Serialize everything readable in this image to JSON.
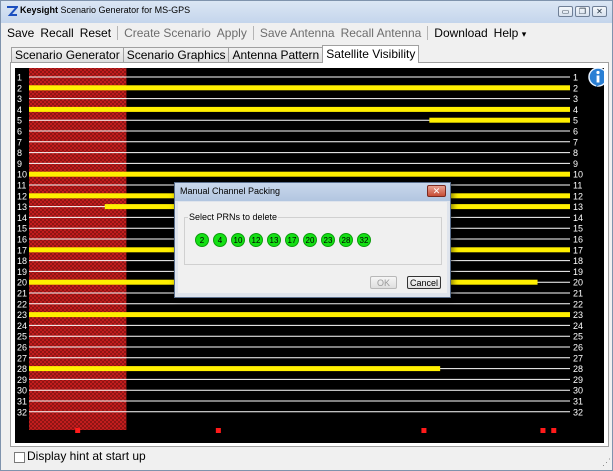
{
  "window": {
    "brand": "Keysight",
    "title": "Scenario Generator for MS-GPS",
    "controls": [
      "minimize-icon",
      "restore-icon",
      "close-icon"
    ]
  },
  "menu": {
    "save": "Save",
    "recall": "Recall",
    "reset": "Reset",
    "create_scenario": "Create Scenario",
    "apply": "Apply",
    "save_antenna": "Save Antenna",
    "recall_antenna": "Recall Antenna",
    "download": "Download",
    "help": "Help",
    "help_arrow": "▾"
  },
  "tabs": [
    "Scenario Generator",
    "Scenario Graphics",
    "Antenna Pattern",
    "Satellite Visibility"
  ],
  "active_tab": 3,
  "plot": {
    "background": "#000000",
    "row_color": "#ffffff",
    "bar_color": "#ffef00",
    "mask_color": "#c81e1e",
    "marker_color": "#ff1a1a",
    "prn_rows": [
      "1",
      "2",
      "3",
      "4",
      "5",
      "6",
      "7",
      "8",
      "9",
      "10",
      "11",
      "12",
      "13",
      "14",
      "15",
      "16",
      "17",
      "18",
      "19",
      "20",
      "21",
      "22",
      "23",
      "24",
      "25",
      "26",
      "27",
      "28",
      "29",
      "30",
      "31",
      "32"
    ],
    "visibility": [
      {
        "prn": 2,
        "from": 0.0,
        "to": 1.0
      },
      {
        "prn": 4,
        "from": 0.0,
        "to": 1.0
      },
      {
        "prn": 5,
        "from": 0.74,
        "to": 1.0
      },
      {
        "prn": 10,
        "from": 0.0,
        "to": 1.0
      },
      {
        "prn": 12,
        "from": 0.0,
        "to": 1.0
      },
      {
        "prn": 13,
        "from": 0.14,
        "to": 1.0
      },
      {
        "prn": 17,
        "from": 0.0,
        "to": 1.0
      },
      {
        "prn": 20,
        "from": 0.0,
        "to": 0.94
      },
      {
        "prn": 23,
        "from": 0.0,
        "to": 1.0
      },
      {
        "prn": 28,
        "from": 0.0,
        "to": 0.76
      }
    ],
    "masked_region": [
      0.0,
      0.18
    ],
    "event_markers": [
      0.09,
      0.35,
      0.73,
      0.95,
      0.97
    ]
  },
  "dialog": {
    "title": "Manual Channel Packing",
    "group_label": "Select PRNs to delete",
    "prns": [
      "2",
      "4",
      "10",
      "12",
      "13",
      "17",
      "20",
      "23",
      "28",
      "32"
    ],
    "ok_label": "OK",
    "cancel_label": "Cancel",
    "close_glyph": "✕"
  },
  "footer": {
    "hint_label": "Display hint at start up",
    "hint_checked": false
  },
  "icons": {
    "info": "info-icon",
    "app_logo": "keysight-logo-icon"
  }
}
